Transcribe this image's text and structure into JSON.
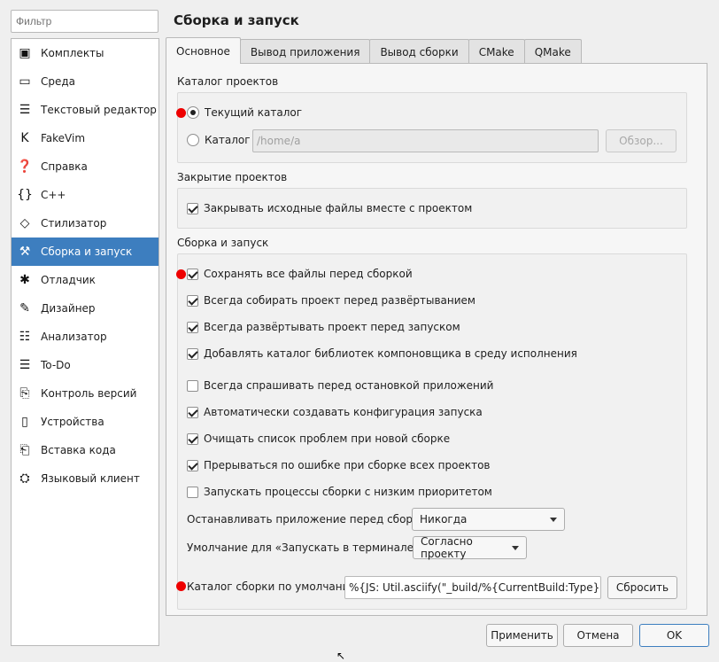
{
  "filter": {
    "placeholder": "Фильтр"
  },
  "sidebar": {
    "items": [
      {
        "label": "Комплекты",
        "icon": "kits-icon",
        "glyph": "▣"
      },
      {
        "label": "Среда",
        "icon": "monitor-icon",
        "glyph": "▭"
      },
      {
        "label": "Текстовый редактор",
        "icon": "text-editor-icon",
        "glyph": "☰"
      },
      {
        "label": "FakeVim",
        "icon": "fakevim-icon",
        "glyph": "K"
      },
      {
        "label": "Справка",
        "icon": "help-icon",
        "glyph": "❓"
      },
      {
        "label": "C++",
        "icon": "cpp-braces-icon",
        "glyph": "{}"
      },
      {
        "label": "Стилизатор",
        "icon": "beautifier-diamond-icon",
        "glyph": "◇"
      },
      {
        "label": "Сборка и запуск",
        "icon": "hammer-icon",
        "glyph": "⚒"
      },
      {
        "label": "Отладчик",
        "icon": "bug-icon",
        "glyph": "✱"
      },
      {
        "label": "Дизайнер",
        "icon": "pencil-icon",
        "glyph": "✎"
      },
      {
        "label": "Анализатор",
        "icon": "analyzer-icon",
        "glyph": "☷"
      },
      {
        "label": "To-Do",
        "icon": "todo-list-icon",
        "glyph": "☰"
      },
      {
        "label": "Контроль версий",
        "icon": "version-control-icon",
        "glyph": "⎘"
      },
      {
        "label": "Устройства",
        "icon": "devices-icon",
        "glyph": "▯"
      },
      {
        "label": "Вставка кода",
        "icon": "code-paste-icon",
        "glyph": "⎗"
      },
      {
        "label": "Языковый клиент",
        "icon": "language-client-icon",
        "glyph": "⛭"
      }
    ],
    "selected_index": 7
  },
  "page_title": "Сборка и запуск",
  "tabs": [
    {
      "label": "Основное"
    },
    {
      "label": "Вывод приложения"
    },
    {
      "label": "Вывод сборки"
    },
    {
      "label": "CMake"
    },
    {
      "label": "QMake"
    }
  ],
  "projects_dir": {
    "title": "Каталог проектов",
    "current_label": "Текущий каталог",
    "dir_label": "Каталог",
    "dir_value": "/home/a",
    "browse_label": "Обзор..."
  },
  "closing": {
    "title": "Закрытие проектов",
    "close_sources_label": "Закрывать исходные файлы вместе с проектом"
  },
  "build_run": {
    "title": "Сборка и запуск",
    "options": [
      {
        "label": "Сохранять все файлы перед сборкой",
        "checked": true
      },
      {
        "label": "Всегда собирать проект перед развёртыванием",
        "checked": true
      },
      {
        "label": "Всегда развёртывать проект перед запуском",
        "checked": true
      },
      {
        "label": "Добавлять каталог библиотек компоновщика в среду исполнения",
        "checked": true
      },
      {
        "label": "Всегда спрашивать перед остановкой приложений",
        "checked": false
      },
      {
        "label": "Автоматически создавать конфигурация запуска",
        "checked": true
      },
      {
        "label": "Очищать список проблем при новой сборке",
        "checked": true
      },
      {
        "label": "Прерываться по ошибке при сборке всех проектов",
        "checked": true
      },
      {
        "label": "Запускать процессы сборки с низким приоритетом",
        "checked": false
      }
    ],
    "stop_before_build_label": "Останавливать приложение перед сборкой:",
    "stop_before_build_value": "Никогда",
    "terminal_default_label": "Умолчание для «Запускать в терминале»:",
    "terminal_default_value": "Согласно проекту",
    "build_dir_label": "Каталог сборки по умолчанию:",
    "build_dir_value": "%{JS: Util.asciify(\"_build/%{CurrentBuild:Type}\")}",
    "reset_label": "Сбросить"
  },
  "footer": {
    "apply_label": "Применить",
    "cancel_label": "Отмена",
    "ok_label": "OK"
  },
  "colors": {
    "selection": "#3d7ebf",
    "marker": "#ee0000"
  }
}
